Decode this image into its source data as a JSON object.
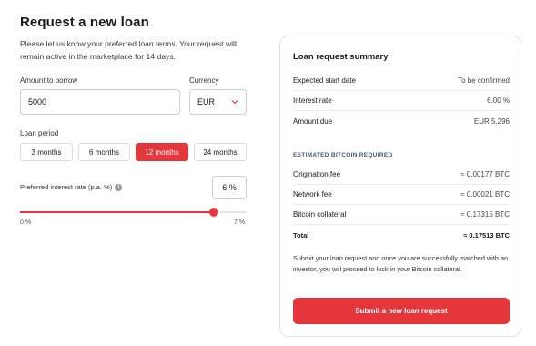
{
  "form": {
    "title": "Request a new loan",
    "description": "Please let us know your preferred loan terms. Your request will remain active in the marketplace for 14 days.",
    "amount_label": "Amount to borrow",
    "amount_value": "5000",
    "currency_label": "Currency",
    "currency_value": "EUR",
    "period_label": "Loan period",
    "periods": [
      "3 months",
      "6 months",
      "12 months",
      "24 months"
    ],
    "selected_period": "12 months",
    "rate_label": "Preferred interest rate (p.a. %)",
    "rate_value": "6 %",
    "slider": {
      "min_label": "0 %",
      "max_label": "7 %",
      "min": 0,
      "max": 7,
      "value": 6
    }
  },
  "summary": {
    "title": "Loan request summary",
    "rows": [
      {
        "label": "Expected start date",
        "value": "To be confirmed"
      },
      {
        "label": "Interest rate",
        "value": "6.00 %"
      },
      {
        "label": "Amount due",
        "value": "EUR 5,296"
      }
    ],
    "btc_section_title": "ESTIMATED BITCOIN REQUIRED",
    "btc_rows": [
      {
        "label": "Origination fee",
        "value": "≈ 0.00177 BTC"
      },
      {
        "label": "Network fee",
        "value": "≈ 0.00021 BTC"
      },
      {
        "label": "Bitcoin collateral",
        "value": "≈ 0.17315 BTC"
      }
    ],
    "total": {
      "label": "Total",
      "value": "≈ 0.17513 BTC"
    },
    "note": "Submit your loan request and once you are successfully matched with an investor, you will proceed to lock in your Bitcoin collateral.",
    "submit_label": "Submit a new loan request"
  },
  "colors": {
    "accent": "#e5373b",
    "section_head": "#41597a"
  },
  "icons": {
    "currency_chevron": "chevron-down-icon",
    "rate_info": "info-icon"
  }
}
